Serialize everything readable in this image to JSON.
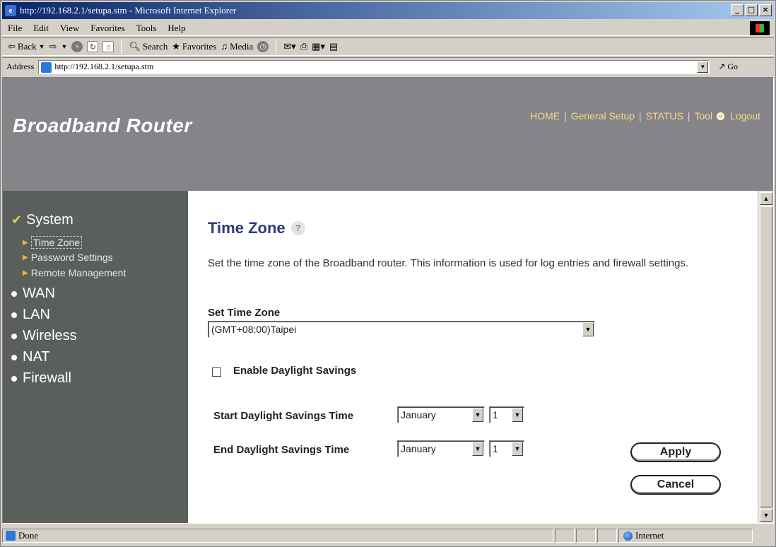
{
  "window": {
    "title": "http://192.168.2.1/setupa.stm - Microsoft Internet Explorer",
    "btn_min": "_",
    "btn_max": "□",
    "btn_close": "×"
  },
  "menu": [
    "File",
    "Edit",
    "View",
    "Favorites",
    "Tools",
    "Help"
  ],
  "toolbar": {
    "back": "Back",
    "search": "Search",
    "favorites": "Favorites",
    "media": "Media"
  },
  "address": {
    "label": "Address",
    "url": "http://192.168.2.1/setupa.stm",
    "go": "Go"
  },
  "header": {
    "brand": "Broadband Router",
    "nav": [
      "HOME",
      "General Setup",
      "STATUS",
      "Tool",
      "Logout"
    ],
    "nav_color": "#f7d98a"
  },
  "sidebar": {
    "section": "System",
    "subitems": [
      "Time Zone",
      "Password Settings",
      "Remote Management"
    ],
    "items": [
      "WAN",
      "LAN",
      "Wireless",
      "NAT",
      "Firewall"
    ]
  },
  "content": {
    "title": "Time Zone",
    "description": "Set the time zone of the Broadband router. This information is used for log entries and firewall settings.",
    "set_tz_label": "Set Time Zone",
    "tz_value": "(GMT+08:00)Taipei",
    "daylight_label": "Enable Daylight Savings",
    "daylight_checked": false,
    "start_label": "Start Daylight Savings Time",
    "start_month": "January",
    "start_day": "1",
    "end_label": "End Daylight Savings Time",
    "end_month": "January",
    "end_day": "1",
    "apply": "Apply",
    "cancel": "Cancel",
    "title_color": "#2e3a7a"
  },
  "status": {
    "text": "Done",
    "zone": "Internet"
  }
}
